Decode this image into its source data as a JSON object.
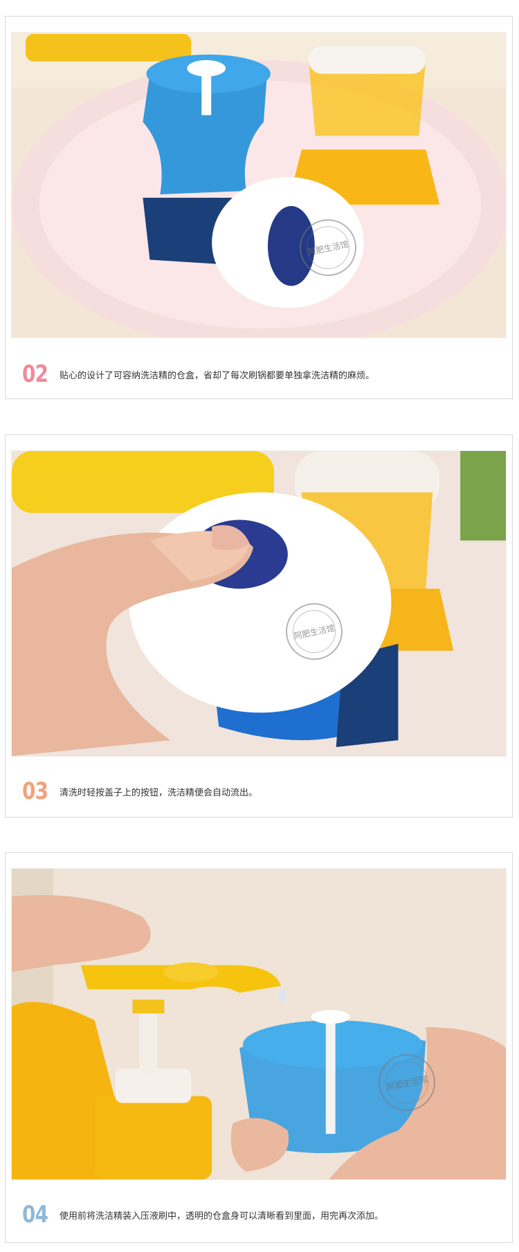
{
  "colors": {
    "step_02": "#f08a9c",
    "step_03": "#f3a17a",
    "step_04": "#8fb8d8",
    "border": "#d9d9d9"
  },
  "steps": [
    {
      "number": "02",
      "text": "贴心的设计了可容纳洗洁精的仓盒，省却了每次刷锅都要单独拿洗洁精的麻烦。"
    },
    {
      "number": "03",
      "text": "清洗时轻按盖子上的按钮，洗洁精便会自动流出。"
    },
    {
      "number": "04",
      "text": "使用前将洗洁精装入压液刷中，透明的仓盒身可以清晰看到里面，用完再次添加。"
    }
  ],
  "watermark": {
    "text": "阿肥生活馆"
  }
}
